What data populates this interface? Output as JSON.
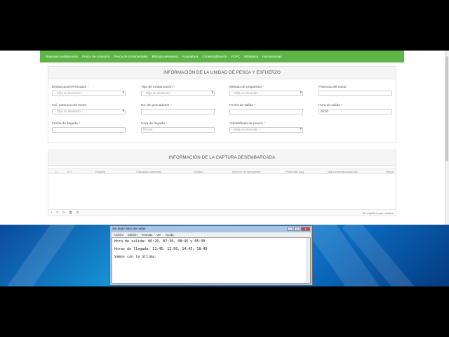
{
  "nav": {
    "items": [
      "Resumen validaciones",
      "Pesca de consumo",
      "Pesca de ornamentales",
      "Biología pesquera",
      "Acuicultura",
      "Comercialización",
      "FOPC",
      "Biblioteca",
      "Herramientas"
    ]
  },
  "panel1": {
    "title": "INFORMACIÓN DE LA UNIDAD DE PESCA Y ESFUERZO",
    "fields": [
      {
        "label": "Embarcación/Pescador",
        "required": "*",
        "value": "-- Elija un elemento --"
      },
      {
        "label": "Tipo de embarcación",
        "required": "*",
        "value": "-- Elija un elemento --"
      },
      {
        "label": "Método de propulsión",
        "required": "*",
        "value": "-- Elija un elemento --"
      },
      {
        "label": "Potencia del motor",
        "required": "",
        "value": ""
      },
      {
        "label": "Uni. potencia del motor",
        "required": "",
        "value": "-- Elija un elemento --"
      },
      {
        "label": "No. de pescadores",
        "required": "*",
        "value": ""
      },
      {
        "label": "Fecha de salida",
        "required": "*",
        "value": ""
      },
      {
        "label": "Hora de salida",
        "required": "*",
        "value": "05:30"
      },
      {
        "label": "Fecha de llegada",
        "required": "*",
        "value": ""
      },
      {
        "label": "Hora de llegada",
        "required": "*",
        "value": "hh:mm"
      },
      {
        "label": "Arte/Método de pesca:",
        "required": "*",
        "value": "-- Elija un elemento --"
      }
    ]
  },
  "panel2": {
    "title": "INFORMACIÓN DE LA CAPTURA DESEMBARCADA",
    "columns": [
      "Id T",
      "Especie",
      "Categoría comercial",
      "Estado",
      "Número de ejemplares",
      "Peso total (kg)",
      "Valor desembarcado ($)",
      "Pesca"
    ],
    "footer_icons": "+ ✎ ⟳ 🗑 ⎘",
    "records": "Sin registros que mostrar"
  },
  "notepad": {
    "title": "Sin título: Bloc de notas",
    "controls": [
      "–",
      "□",
      "x"
    ],
    "menu": [
      "Archivo",
      "Edición",
      "Formato",
      "Ver",
      "Ayuda"
    ],
    "lines": [
      "Hora de salida: 06:20, 07:30, 08:45 y 05:30",
      "Horas de llegada: 12:45, 12:50, 14:45, 18:40",
      "Vamos con la última."
    ]
  },
  "colors": {
    "navbar": "#5cb544",
    "desktop": "#0b6cc0"
  }
}
